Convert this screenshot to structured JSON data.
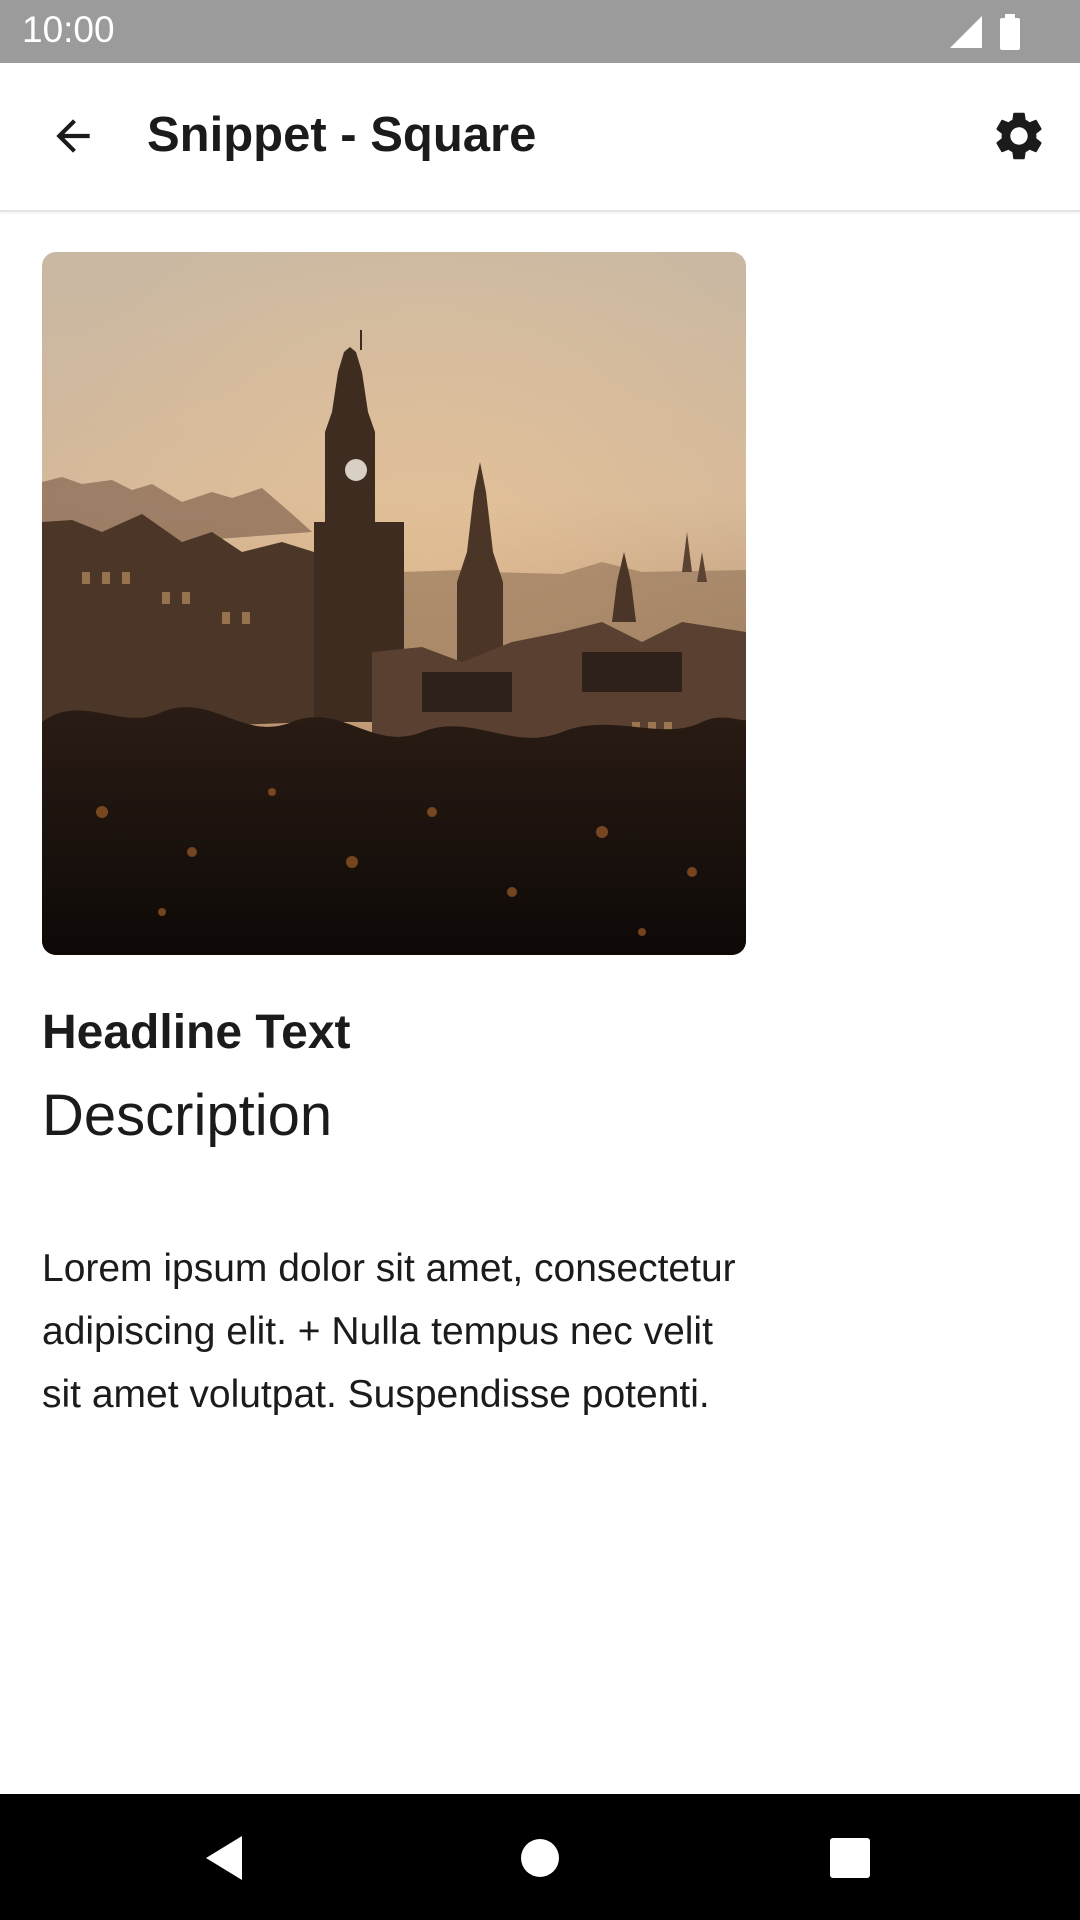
{
  "status_bar": {
    "time": "10:00",
    "icons": [
      "signal-icon",
      "battery-icon"
    ]
  },
  "app_bar": {
    "title": "Snippet - Square",
    "back_icon": "arrow-back-icon",
    "settings_icon": "gear-icon"
  },
  "snippet": {
    "image": "city-skyline-sunset-photo",
    "headline": "Headline Text",
    "description": "Description",
    "body": "Lorem ipsum dolor sit amet, consectetur adipiscing elit. + Nulla tempus nec velit sit amet volutpat. Suspendisse potenti."
  },
  "nav_bar": {
    "buttons": [
      "back-triangle-icon",
      "home-circle-icon",
      "recents-square-icon"
    ]
  },
  "colors": {
    "status_bar": "#9b9b9b",
    "nav_bar": "#000000",
    "text": "#1b1b1b"
  }
}
